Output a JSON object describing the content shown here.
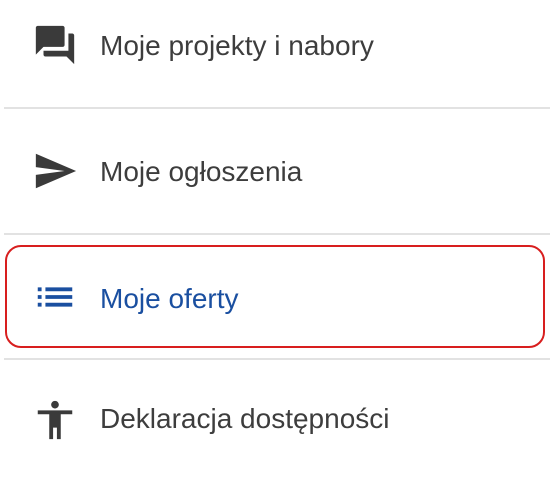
{
  "menu": {
    "items": [
      {
        "label": "Moje projekty i nabory",
        "icon": "forum-icon",
        "active": false
      },
      {
        "label": "Moje ogłoszenia",
        "icon": "send-icon",
        "active": false
      },
      {
        "label": "Moje oferty",
        "icon": "list-icon",
        "active": true
      },
      {
        "label": "Deklaracja dostępności",
        "icon": "accessibility-icon",
        "active": false
      }
    ]
  },
  "colors": {
    "text": "#3d3d3d",
    "icon": "#3a3a3a",
    "active": "#1a4fa0",
    "highlight_border": "#d81e1e",
    "divider": "#e2e2e2"
  }
}
